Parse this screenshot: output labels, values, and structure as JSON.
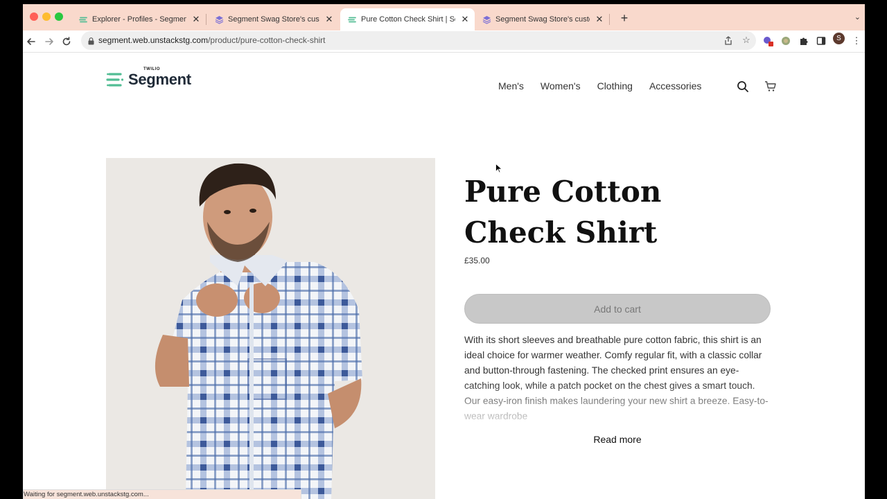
{
  "browser": {
    "tabs": [
      {
        "title": "Explorer - Profiles - Segment",
        "favicon": "segment-logo-icon"
      },
      {
        "title": "Segment Swag Store's custom",
        "favicon": "stack-icon"
      },
      {
        "title": "Pure Cotton Check Shirt | Seg",
        "favicon": "segment-logo-icon"
      },
      {
        "title": "Segment Swag Store's custom",
        "favicon": "stack-icon"
      }
    ],
    "url_host": "segment.web.unstackstg.com",
    "url_path": "/product/pure-cotton-check-shirt",
    "profile_initial": "S",
    "status_text": "Waiting for segment.web.unstackstg.com...",
    "colors": {
      "tabstrip": "#f9d9cc",
      "active_tab": "#ffffff"
    }
  },
  "site": {
    "logo_small": "TWILIO",
    "logo_word": "Segment",
    "nav": [
      "Men's",
      "Women's",
      "Clothing",
      "Accessories"
    ],
    "brand_green": "#52bd94"
  },
  "product": {
    "title": "Pure Cotton Check Shirt",
    "price": "£35.00",
    "add_to_cart": "Add to cart",
    "description": "With its short sleeves and breathable pure cotton fabric, this shirt is an ideal choice for warmer weather. Comfy regular fit, with a classic collar and button-through fastening. The checked print ensures an eye-catching look, while a patch pocket on the chest gives a smart touch. Our easy-iron finish makes laundering your new shirt a breeze. Easy-to-wear wardrobe",
    "read_more": "Read more"
  }
}
